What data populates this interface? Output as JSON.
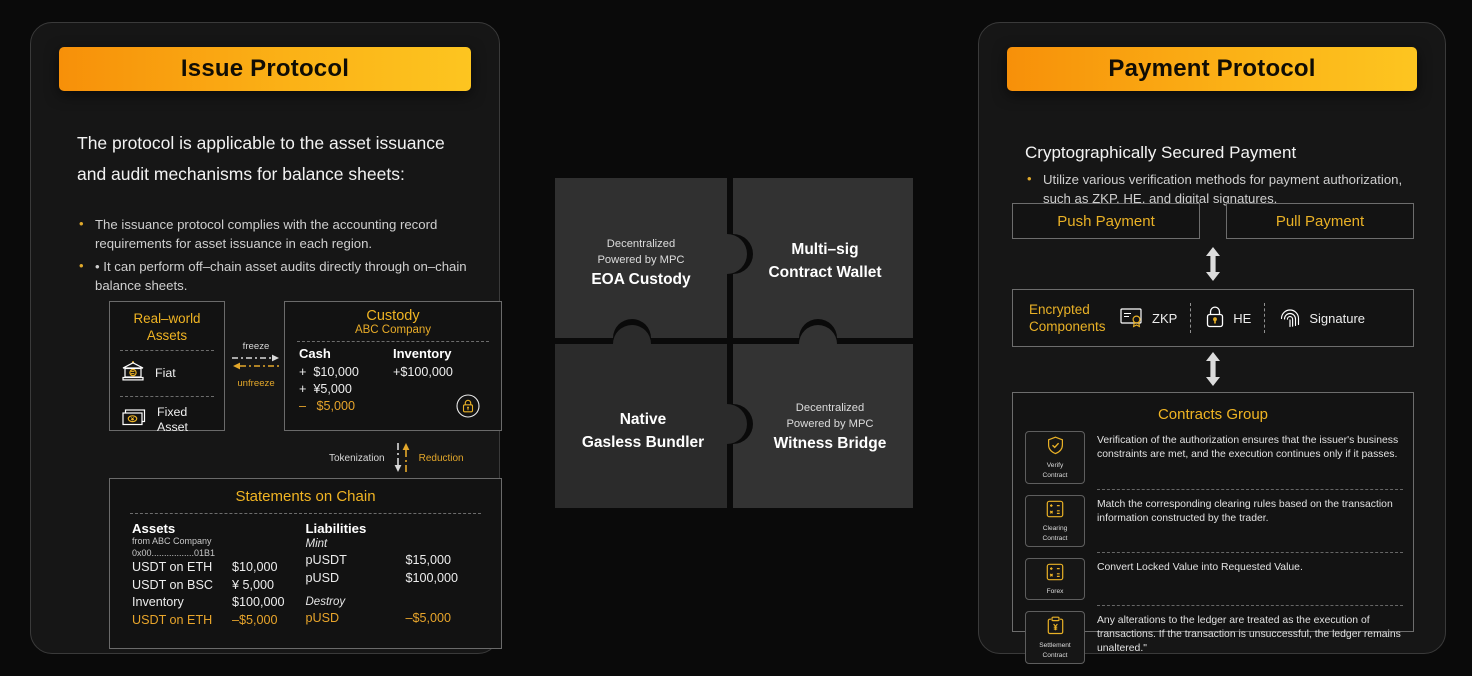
{
  "colors": {
    "accent_amber": "#e9b126",
    "header_gradient_start": "#f79009",
    "header_gradient_end": "#fdc520",
    "panel_bg": "#161616",
    "page_bg": "#0a0a0a",
    "text_primary": "#f2f2f2",
    "text_muted": "#cfcfcf",
    "puzzle_piece": "#303030"
  },
  "issue": {
    "header": "Issue Protocol",
    "intro": "The protocol is applicable to the asset issuance and audit mechanisms for balance sheets:",
    "bullets": [
      "The issuance protocol complies with the accounting record requirements for asset issuance in each region.",
      "• It can perform off–chain asset audits directly through on–chain balance sheets."
    ],
    "rwa": {
      "title_line1": "Real–world",
      "title_line2": "Assets",
      "items": [
        {
          "icon": "bank-euro-icon",
          "label": "Fiat"
        },
        {
          "icon": "cash-stack-icon",
          "label_line1": "Fixed",
          "label_line2": "Asset"
        }
      ]
    },
    "flow": {
      "freeze": "freeze",
      "unfreeze": "unfreeze",
      "tokenization": "Tokenization",
      "reduction": "Reduction"
    },
    "custody": {
      "title": "Custody",
      "subtitle": "ABC Company",
      "cash_header": "Cash",
      "cash_lines": [
        "+  $10,000",
        "+  ¥5,000",
        "–   $5,000"
      ],
      "inventory_header": "Inventory",
      "inventory_lines": [
        "+$100,000"
      ],
      "lock_icon": "lock-circle-icon"
    },
    "statements": {
      "title": "Statements on Chain",
      "assets_header": "Assets",
      "assets_from": "from ABC Company",
      "assets_address": "0x00.................01B1",
      "assets_rows": [
        {
          "k": "USDT on ETH",
          "v": "$10,000",
          "amber": false
        },
        {
          "k": "USDT on BSC",
          "v": "¥ 5,000",
          "amber": false
        },
        {
          "k": "Inventory",
          "v": "$100,000",
          "amber": false
        },
        {
          "k": "USDT on ETH",
          "v": "–$5,000",
          "amber": true
        }
      ],
      "liabilities_header": "Liabilities",
      "mint_label": "Mint",
      "mint_rows": [
        {
          "k": "pUSDT",
          "v": "$15,000",
          "amber": false
        },
        {
          "k": "pUSD",
          "v": "$100,000",
          "amber": false
        }
      ],
      "destroy_label": "Destroy",
      "destroy_rows": [
        {
          "k": "pUSD",
          "v": "–$5,000",
          "amber": true
        }
      ]
    }
  },
  "puzzle": {
    "pieces": [
      {
        "small_line1": "Decentralized",
        "small_line2": "Powered by MPC",
        "big_line1": "EOA Custody",
        "big_line2": ""
      },
      {
        "small_line1": "",
        "small_line2": "",
        "big_line1": "Multi–sig",
        "big_line2": "Contract Wallet"
      },
      {
        "small_line1": "",
        "small_line2": "",
        "big_line1": "Native",
        "big_line2": "Gasless Bundler"
      },
      {
        "small_line1": "Decentralized",
        "small_line2": "Powered by MPC",
        "big_line1": "Witness Bridge",
        "big_line2": ""
      }
    ]
  },
  "payment": {
    "header": "Payment Protocol",
    "section_title": "Cryptographically Secured Payment",
    "bullets": [
      "Utilize various verification methods for payment authorization, such as ZKP, HE, and digital signatures."
    ],
    "push_label": "Push Payment",
    "pull_label": "Pull Payment",
    "encrypted": {
      "label_line1": "Encrypted",
      "label_line2": "Components",
      "items": [
        {
          "icon": "certificate-icon",
          "label": "ZKP"
        },
        {
          "icon": "padlock-icon",
          "label": "HE"
        },
        {
          "icon": "fingerprint-icon",
          "label": "Signature"
        }
      ]
    },
    "contracts": {
      "title": "Contracts Group",
      "rows": [
        {
          "icon": "shield-check-icon",
          "chip_line1": "Verify",
          "chip_line2": "Contract",
          "text": "Verification of the authorization ensures that the issuer's business constraints are met, and the execution continues only if it passes."
        },
        {
          "icon": "calculator-icon",
          "chip_line1": "Clearing",
          "chip_line2": "Contract",
          "text": "Match the corresponding clearing rules based on the transaction information constructed by the trader."
        },
        {
          "icon": "calculator-icon",
          "chip_line1": "Forex",
          "chip_line2": "",
          "text": "Convert Locked Value into Requested Value."
        },
        {
          "icon": "clipboard-yen-icon",
          "chip_line1": "Settlement",
          "chip_line2": "Contract",
          "text": "Any alterations to the ledger are treated as the execution of transactions. If the transaction is unsuccessful, the ledger remains unaltered.\""
        }
      ]
    }
  }
}
